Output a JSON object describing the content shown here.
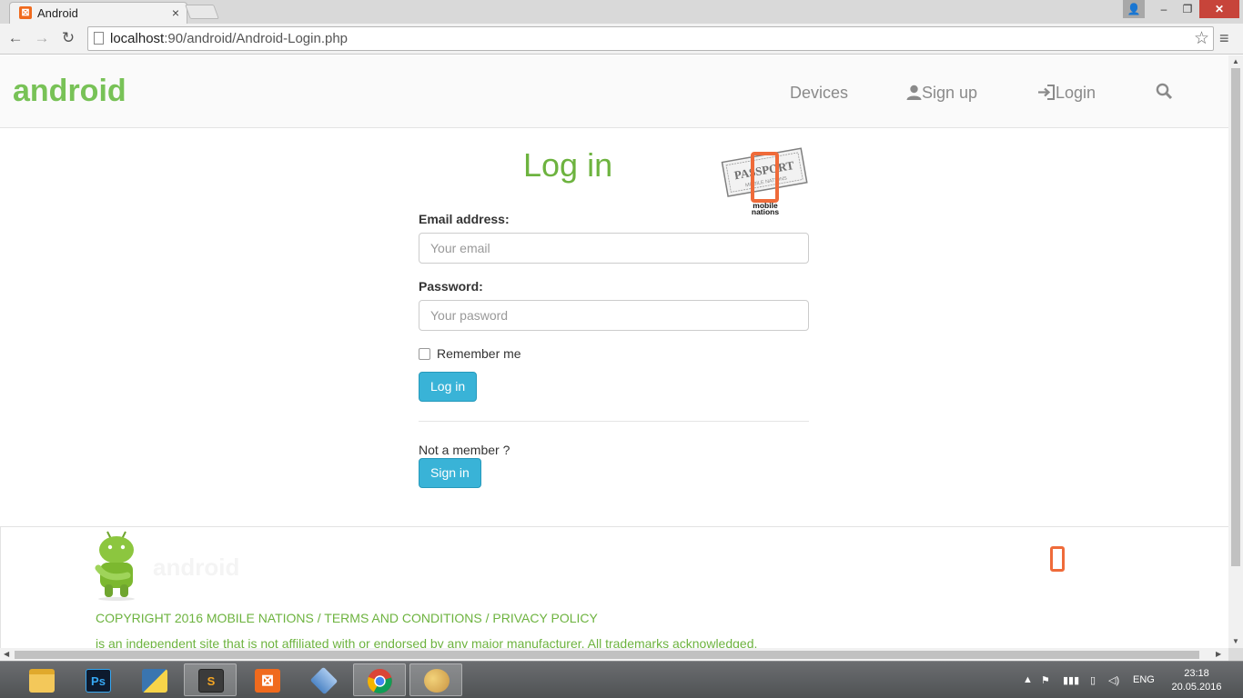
{
  "browser": {
    "tab_title": "Android",
    "tab_close_icon": "×",
    "url_host": "localhost",
    "url_rest": ":90/android/Android-Login.php",
    "back_icon": "←",
    "forward_icon": "→",
    "reload_icon": "↻",
    "star_icon": "☆",
    "menu_icon": "≡",
    "win_user_icon": "👤",
    "win_min_icon": "–",
    "win_max_icon": "❐",
    "win_close_icon": "✕"
  },
  "header": {
    "brand": "android",
    "nav": {
      "devices": "Devices",
      "signup": "Sign up",
      "login": "Login"
    },
    "search_icon": "search-icon"
  },
  "login": {
    "title": "Log in",
    "email_label": "Email address:",
    "email_placeholder": "Your email",
    "email_value": "",
    "password_label": "Password:",
    "password_placeholder": "Your pasword",
    "password_value": "",
    "remember_label": "Remember me",
    "remember_checked": false,
    "login_button": "Log in",
    "not_member": "Not a member ?",
    "signin_button": "Sign in"
  },
  "passport": {
    "stamp_text": "PASSPORT",
    "stamp_subtext": "MOBILE NATIONS",
    "logo_line1": "mobile",
    "logo_line2": "nations"
  },
  "footer": {
    "copyright": "COPYRIGHT 2016 MOBILE NATIONS / TERMS AND CONDITIONS / PRIVACY POLICY",
    "disclaimer": "is an independent site that is not affiliated with or endorsed by any major manufacturer. All trademarks acknowledged."
  },
  "taskbar": {
    "apps": [
      {
        "name": "file-explorer",
        "label": ""
      },
      {
        "name": "photoshop",
        "label": "Ps"
      },
      {
        "name": "python",
        "label": ""
      },
      {
        "name": "sublime-text",
        "label": "S"
      },
      {
        "name": "xampp",
        "label": ""
      },
      {
        "name": "virtualbox",
        "label": ""
      },
      {
        "name": "chrome",
        "label": ""
      },
      {
        "name": "paint",
        "label": ""
      }
    ],
    "language": "ENG",
    "time": "23:18",
    "date": "20.05.2016"
  },
  "colors": {
    "brand_green": "#78c257",
    "title_green": "#6db33f",
    "button_info": "#39b3d7",
    "accent_orange": "#ef6b3a"
  }
}
